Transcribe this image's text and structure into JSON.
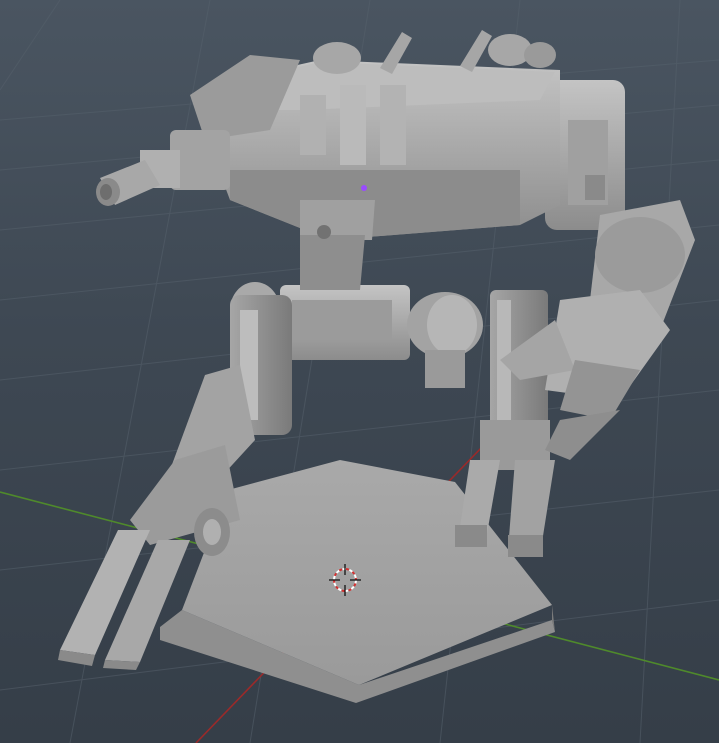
{
  "viewport": {
    "background_top": "#4a5561",
    "background_bottom": "#353e48",
    "grid_color": "#56616c",
    "x_axis_color": "#9a2a2a",
    "y_axis_color": "#4f8a2b",
    "model_base": "#9d9d9d",
    "model_light": "#b9b9b9",
    "model_dark": "#6f6f6f",
    "selected_vertex_color": "#9a4bff"
  },
  "icons": {
    "origin_marker": "3d-cursor-icon"
  }
}
